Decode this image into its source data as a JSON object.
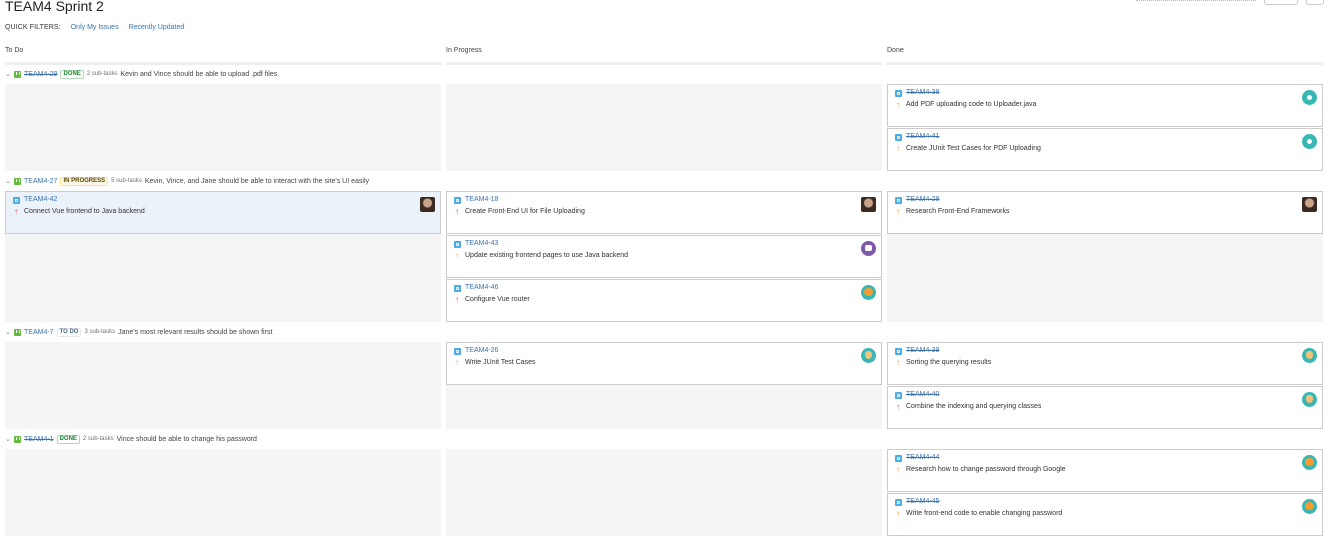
{
  "board": {
    "title": "TEAM4 Sprint 2",
    "quick_filters_label": "QUICK FILTERS:",
    "quick_filters": [
      "Only My Issues",
      "Recently Updated"
    ]
  },
  "columns": [
    "To Do",
    "In Progress",
    "Done"
  ],
  "swimlanes": [
    {
      "key": "TEAM4-29",
      "status": "DONE",
      "subtasks": "2 sub-tasks",
      "summary": "Kevin and Vince should be able to upload .pdf files."
    },
    {
      "key": "TEAM4-27",
      "status": "IN PROGRESS",
      "subtasks": "5 sub-tasks",
      "summary": "Kevin, Vince, and Jane should be able to interact with the site's UI easily"
    },
    {
      "key": "TEAM4-7",
      "status": "TO DO",
      "subtasks": "3 sub-tasks",
      "summary": "Jane's most relevant results should be shown first"
    },
    {
      "key": "TEAM4-1",
      "status": "DONE",
      "subtasks": "2 sub-tasks",
      "summary": "Vince should be able to change his password"
    }
  ],
  "cards": [
    {
      "key": "TEAM4-38",
      "summary": "Add PDF uploading code to Uploader.java",
      "priority": "medium",
      "avatar": "teal-avatar"
    },
    {
      "key": "TEAM4-41",
      "summary": "Create JUnit Test Cases for PDF Uploading",
      "priority": "medium",
      "avatar": "teal-avatar"
    },
    {
      "key": "TEAM4-42",
      "summary": "Connect Vue frontend to Java backend",
      "priority": "high",
      "avatar": "photo-avatar"
    },
    {
      "key": "TEAM4-18",
      "summary": "Create Front-End UI for File Uploading",
      "priority": "high",
      "avatar": "photo-avatar"
    },
    {
      "key": "TEAM4-43",
      "summary": "Update existing frontend pages to use Java backend",
      "priority": "medium",
      "avatar": "robot-avatar"
    },
    {
      "key": "TEAM4-46",
      "summary": "Configure Vue router",
      "priority": "high",
      "avatar": "tiger-avatar"
    },
    {
      "key": "TEAM4-28",
      "summary": "Research Front-End Frameworks",
      "priority": "medium",
      "avatar": "photo-avatar"
    },
    {
      "key": "TEAM4-26",
      "summary": "Write JUnit Test Cases",
      "priority": "medium",
      "avatar": "dog-avatar"
    },
    {
      "key": "TEAM4-39",
      "summary": "Sorting the querying results",
      "priority": "medium",
      "avatar": "dog-avatar"
    },
    {
      "key": "TEAM4-40",
      "summary": "Combine the indexing and querying classes",
      "priority": "high",
      "avatar": "dog-avatar"
    },
    {
      "key": "TEAM4-44",
      "summary": "Research how to change password through Google",
      "priority": "medium",
      "avatar": "tiger-avatar"
    },
    {
      "key": "TEAM4-45",
      "summary": "Write front-end code to enable changing password",
      "priority": "medium",
      "avatar": "tiger-avatar"
    }
  ]
}
